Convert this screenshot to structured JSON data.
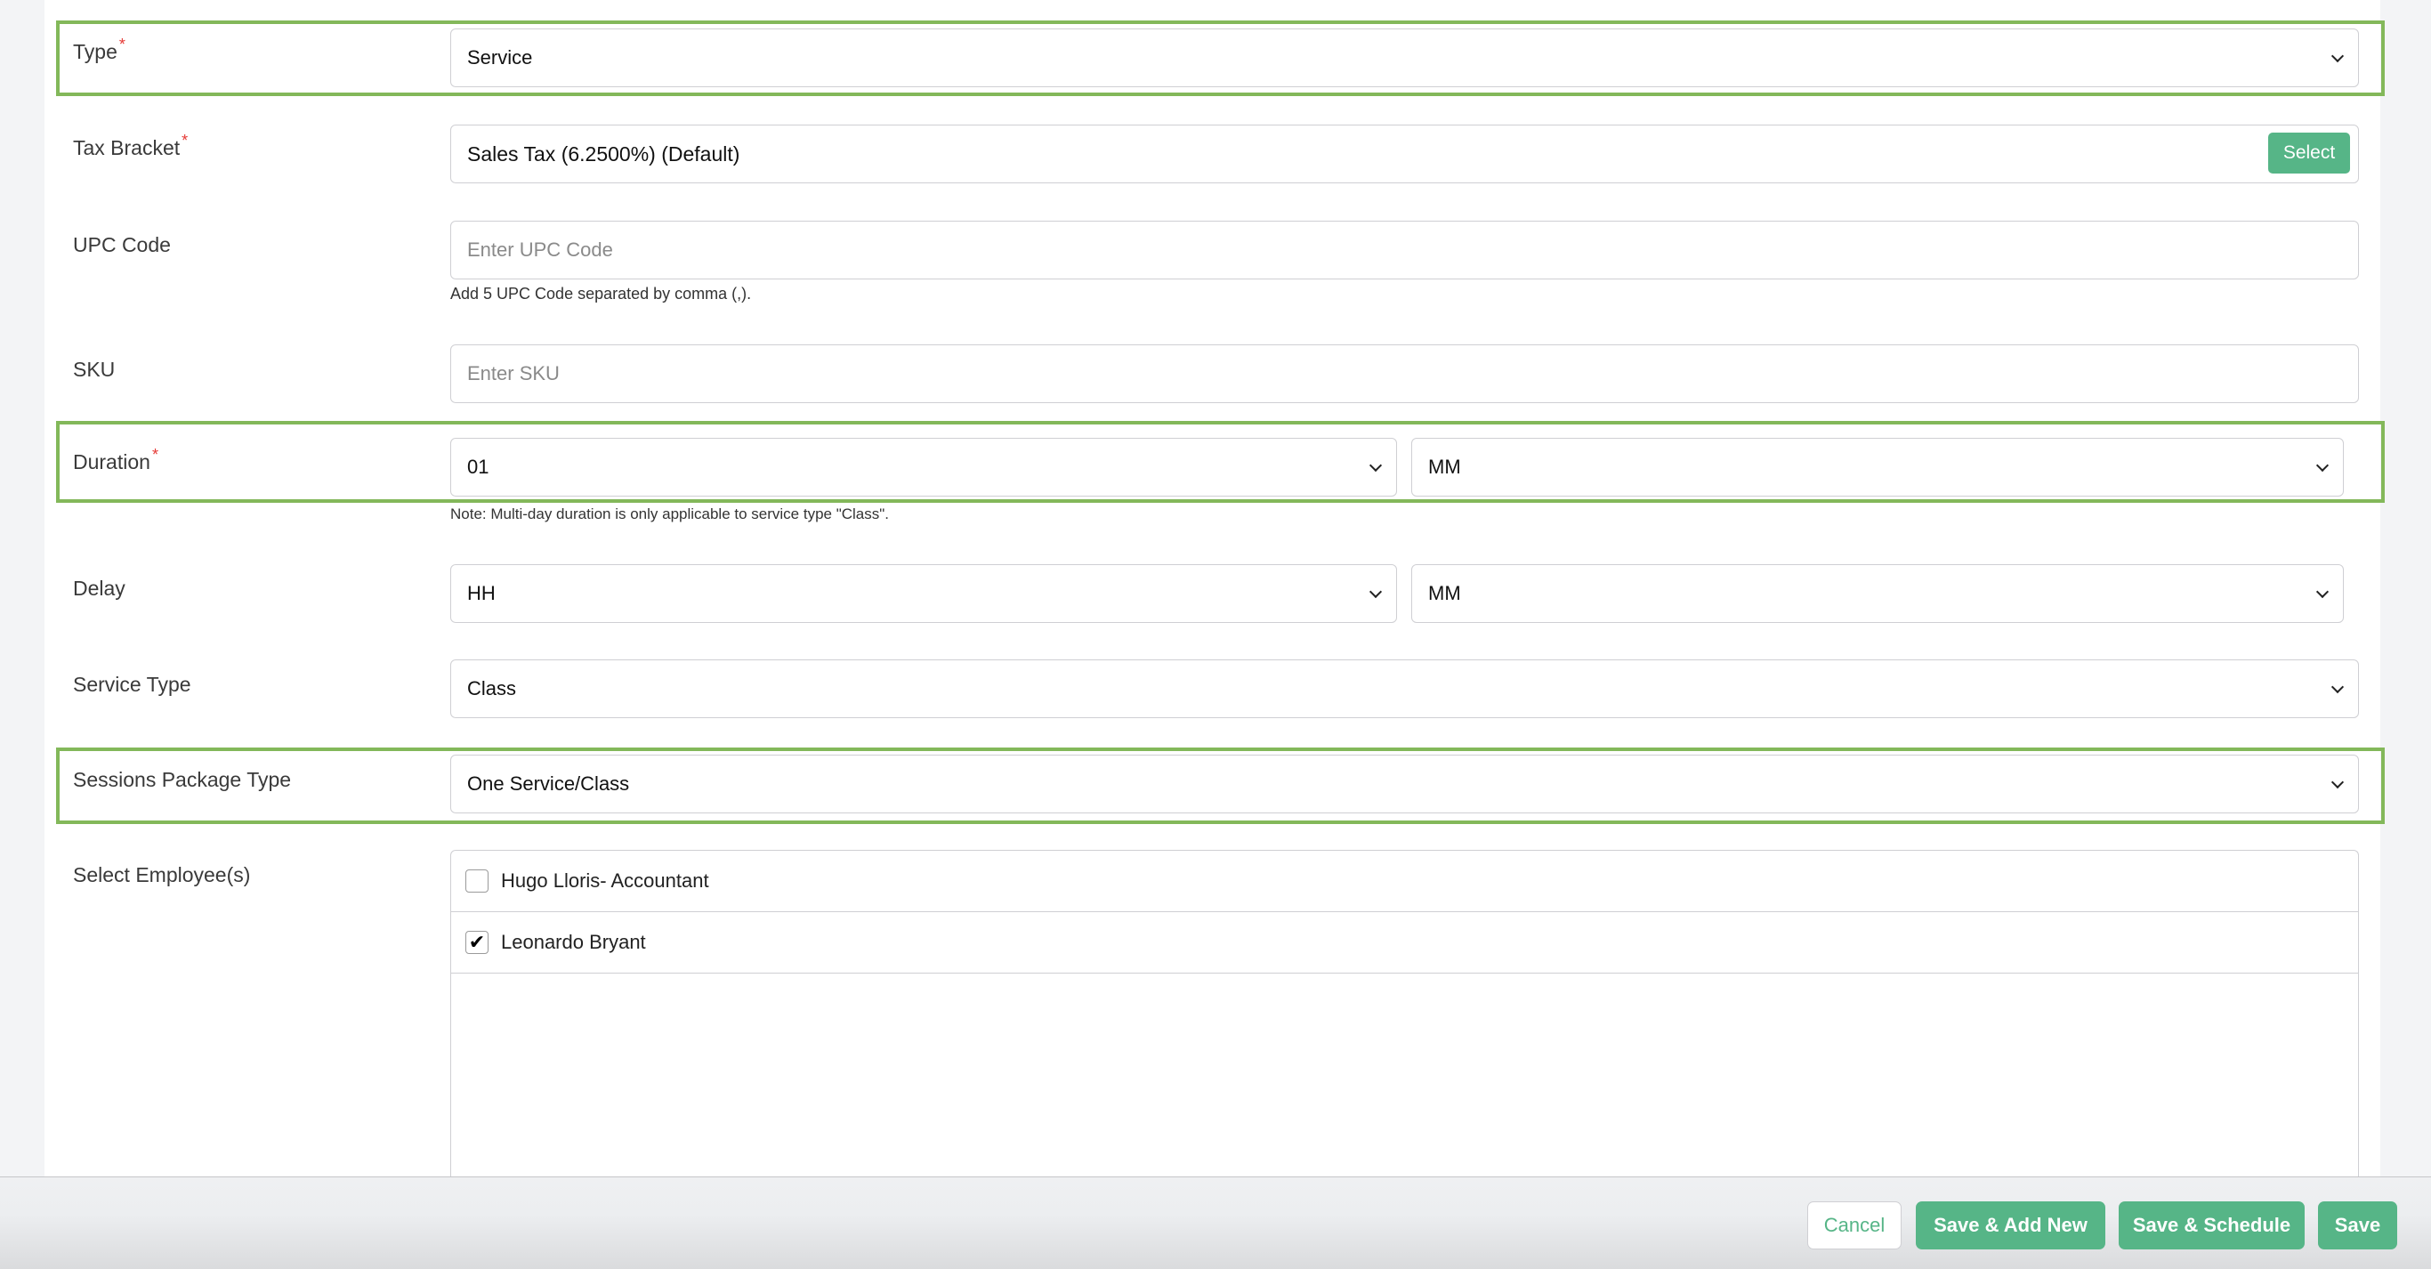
{
  "form": {
    "type": {
      "label": "Type",
      "required": "*",
      "value": "Service"
    },
    "tax_bracket": {
      "label": "Tax Bracket",
      "required": "*",
      "value": "Sales Tax (6.2500%) (Default)",
      "select_button": "Select"
    },
    "upc_code": {
      "label": "UPC Code",
      "placeholder": "Enter UPC Code",
      "help": "Add 5 UPC Code separated by comma (,)."
    },
    "sku": {
      "label": "SKU",
      "placeholder": "Enter SKU"
    },
    "duration": {
      "label": "Duration",
      "required": "*",
      "hours": "01",
      "minutes": "MM",
      "note": "Note: Multi-day duration is only applicable to service type \"Class\"."
    },
    "delay": {
      "label": "Delay",
      "hours": "HH",
      "minutes": "MM"
    },
    "service_type": {
      "label": "Service Type",
      "value": "Class"
    },
    "sessions_package_type": {
      "label": "Sessions Package Type",
      "value": "One Service/Class"
    },
    "employees": {
      "label": "Select Employee(s)",
      "items": [
        {
          "name": "Hugo Lloris- Accountant",
          "checked": false,
          "mark": ""
        },
        {
          "name": "Leonardo Bryant",
          "checked": true,
          "mark": "✔"
        }
      ]
    }
  },
  "footer": {
    "cancel": "Cancel",
    "save_add_new": "Save & Add New",
    "save_schedule": "Save & Schedule",
    "save": "Save"
  },
  "colors": {
    "accent": "#56b587",
    "highlight": "#83b85a",
    "required": "#e53935"
  }
}
